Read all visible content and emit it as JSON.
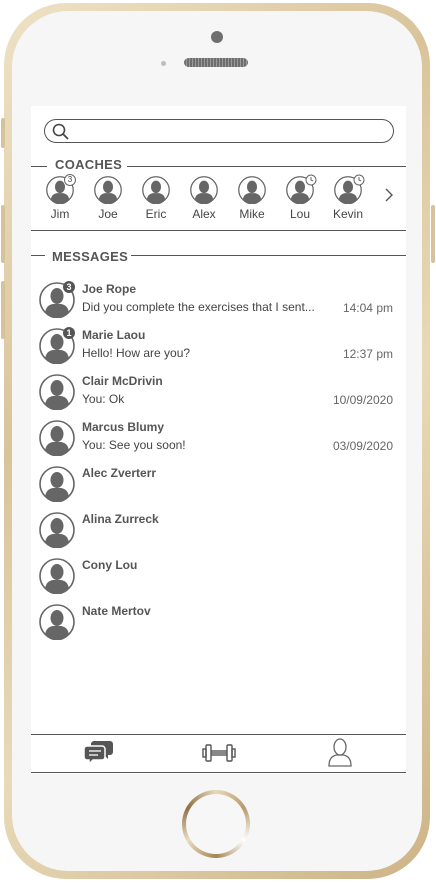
{
  "search": {
    "placeholder": ""
  },
  "coaches": {
    "title": "COACHES",
    "items": [
      {
        "name": "Jim",
        "badge": "3",
        "status": "count"
      },
      {
        "name": "Joe",
        "badge": "",
        "status": "none"
      },
      {
        "name": "Eric",
        "badge": "",
        "status": "none"
      },
      {
        "name": "Alex",
        "badge": "",
        "status": "none"
      },
      {
        "name": "Mike",
        "badge": "",
        "status": "none"
      },
      {
        "name": "Lou",
        "badge": "",
        "status": "clock"
      },
      {
        "name": "Kevin",
        "badge": "",
        "status": "clock"
      }
    ]
  },
  "messages": {
    "title": "MESSAGES",
    "items": [
      {
        "name": "Joe Rope",
        "text": "Did you complete the exercises that I sent...",
        "time": "14:04 pm",
        "unread": "3"
      },
      {
        "name": "Marie Laou",
        "text": "Hello! How are you?",
        "time": "12:37 pm",
        "unread": "1"
      },
      {
        "name": "Clair McDrivin",
        "text": "You: Ok",
        "time": "10/09/2020",
        "unread": ""
      },
      {
        "name": "Marcus Blumy",
        "text": "You: See you soon!",
        "time": "03/09/2020",
        "unread": ""
      },
      {
        "name": "Alec Zverterr",
        "text": "",
        "time": "",
        "unread": ""
      },
      {
        "name": "Alina Zurreck",
        "text": "",
        "time": "",
        "unread": ""
      },
      {
        "name": "Cony Lou",
        "text": "",
        "time": "",
        "unread": ""
      },
      {
        "name": "Nate Mertov",
        "text": "",
        "time": "",
        "unread": ""
      }
    ]
  },
  "tabbar": {
    "tabs": [
      {
        "icon": "chat-icon",
        "active": true
      },
      {
        "icon": "dumbbell-icon",
        "active": false
      },
      {
        "icon": "profile-icon",
        "active": false
      }
    ]
  },
  "colors": {
    "accent": "#555555",
    "frame": "#d9c49a",
    "avatar": "#666666"
  }
}
